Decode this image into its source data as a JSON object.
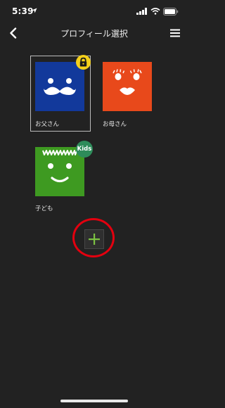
{
  "status_bar": {
    "time": "5:39"
  },
  "nav": {
    "title": "プロフィール選択"
  },
  "profiles": [
    {
      "name": "お父さん",
      "color": "#12399b",
      "badge": "lock"
    },
    {
      "name": "お母さん",
      "color": "#e8491b"
    },
    {
      "name": "子ども",
      "color": "#3e9a21",
      "badge": "Kids"
    }
  ],
  "colors": {
    "background": "#222222",
    "lock_badge": "#f4d01a",
    "kids_badge": "#2e8b5a",
    "add_plus": "#7cc242",
    "highlight": "#e3000f"
  }
}
